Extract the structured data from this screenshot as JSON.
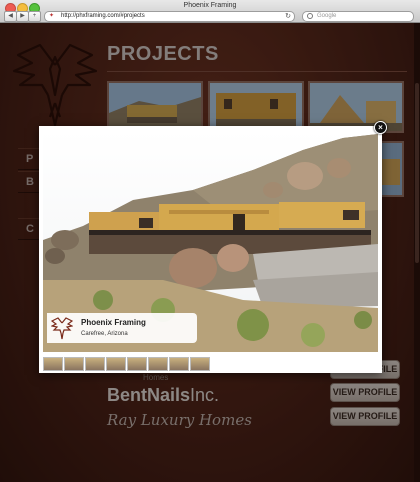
{
  "window": {
    "title": "Phoenix Framing"
  },
  "browser": {
    "url": "http://phxframing.com/#projects",
    "search_placeholder": "Google"
  },
  "page": {
    "title": "PROJECTS",
    "side_nav": [
      "P",
      "B",
      "C"
    ],
    "brands": {
      "bentnails_bold": "BentNails",
      "bentnails_light": "Inc.",
      "ray": "Ray Luxury Homes",
      "homes_partial": "Homes"
    },
    "view_profile_labels": [
      "VIEW PROFILE",
      "VIEW PROFILE",
      "VIEW PROFILE"
    ]
  },
  "lightbox": {
    "caption_name": "Phoenix Framing",
    "caption_location": "Carefree, Arizona",
    "close_label": "×",
    "filmstrip_count": 8
  },
  "colors": {
    "accent": "#c9c1bd",
    "background": "#4a2116",
    "button": "#c9bfb8"
  }
}
